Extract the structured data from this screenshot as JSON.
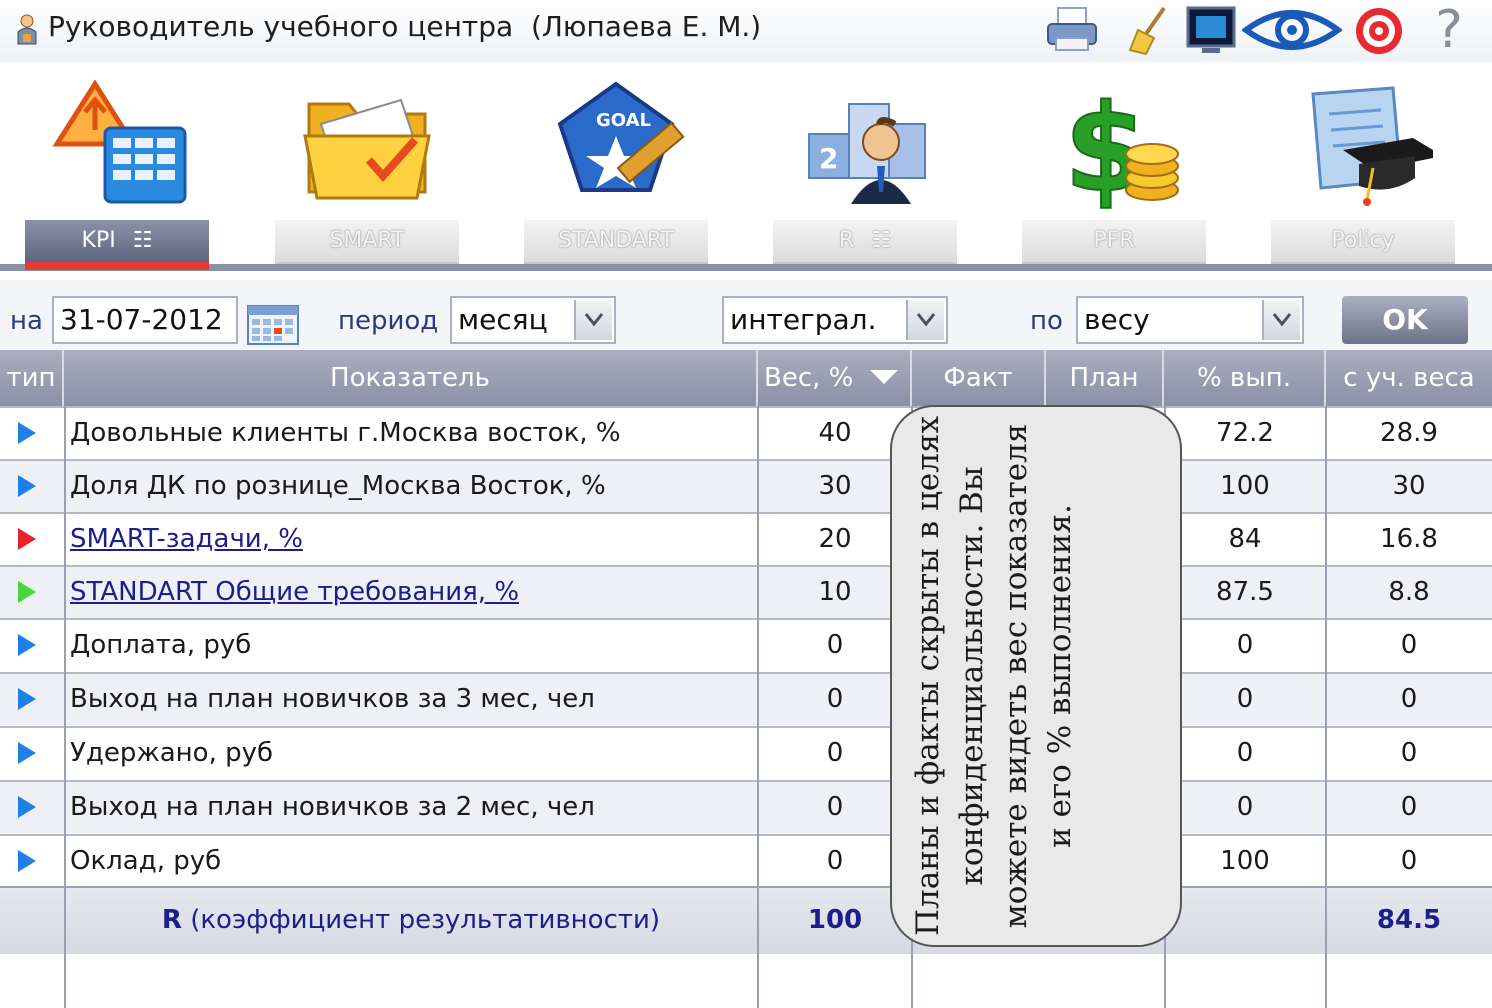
{
  "window": {
    "title": "Руководитель учебного центра  (Люпаева Е. М.)",
    "toolbar_icons": [
      "printer-icon",
      "broom-icon",
      "monitor-icon",
      "eye-icon",
      "target-icon",
      "help-icon"
    ],
    "help_glyph": "?"
  },
  "modules": [
    {
      "label": "KPI",
      "icon": "kpi-icon",
      "active": true
    },
    {
      "label": "SMART",
      "icon": "folder-icon",
      "active": false
    },
    {
      "label": "STANDART",
      "icon": "goal-icon",
      "active": false
    },
    {
      "label": "R",
      "icon": "podium-icon",
      "active": false
    },
    {
      "label": "PFR",
      "icon": "dollar-icon",
      "active": false
    },
    {
      "label": "Policy",
      "icon": "graduation-icon",
      "active": false
    }
  ],
  "kpi_glyph": "☷",
  "filters": {
    "date_label": "на",
    "date_value": "31-07-2012",
    "period_label": "период",
    "period_value": "месяц",
    "mode_value": "интеграл.",
    "sort_label": "по",
    "sort_value": "весу",
    "ok_label": "OK"
  },
  "table": {
    "columns": [
      "тип",
      "Показатель",
      "Вес, %",
      "Факт",
      "План",
      "% вып.",
      "с уч. веса"
    ],
    "rows": [
      {
        "type": "blue",
        "name": "Довольные клиенты г.Москва восток, %",
        "link": false,
        "weight": "40",
        "pct": "72.2",
        "weighted": "28.9"
      },
      {
        "type": "blue",
        "name": "Доля ДК по рознице_Москва Восток, %",
        "link": false,
        "weight": "30",
        "pct": "100",
        "weighted": "30"
      },
      {
        "type": "red",
        "name": "SMART-задачи, %",
        "link": true,
        "weight": "20",
        "pct": "84",
        "weighted": "16.8"
      },
      {
        "type": "green",
        "name": "STANDART Общие требования, %",
        "link": true,
        "weight": "10",
        "pct": "87.5",
        "weighted": "8.8"
      },
      {
        "type": "blue",
        "name": "Доплата, руб",
        "link": false,
        "weight": "0",
        "pct": "0",
        "weighted": "0"
      },
      {
        "type": "blue",
        "name": "Выход на план новичков за 3 мес, чел",
        "link": false,
        "weight": "0",
        "pct": "0",
        "weighted": "0"
      },
      {
        "type": "blue",
        "name": "Удержано, руб",
        "link": false,
        "weight": "0",
        "pct": "0",
        "weighted": "0"
      },
      {
        "type": "blue",
        "name": "Выход на план новичков за 2 мес, чел",
        "link": false,
        "weight": "0",
        "pct": "0",
        "weighted": "0"
      },
      {
        "type": "blue",
        "name": "Оклад, руб",
        "link": false,
        "weight": "0",
        "pct": "100",
        "weighted": "0"
      }
    ],
    "total": {
      "label_bold": "R",
      "label": "(коэффициент результативности)",
      "weight": "100",
      "weighted": "84.5"
    }
  },
  "note": {
    "text": "Планы и факты скрыты в целях конфиденциальности. Вы можете видеть вес показателя и его % выполнения."
  },
  "colors": {
    "header_bg": "#9aa0b4",
    "active_tab_bg": "#6c7489",
    "active_tab_underline": "#e63a32",
    "marker_blue": "#1f7fe8",
    "marker_red": "#e8222a",
    "marker_green": "#4bd43c",
    "link": "#1c1e8a"
  }
}
